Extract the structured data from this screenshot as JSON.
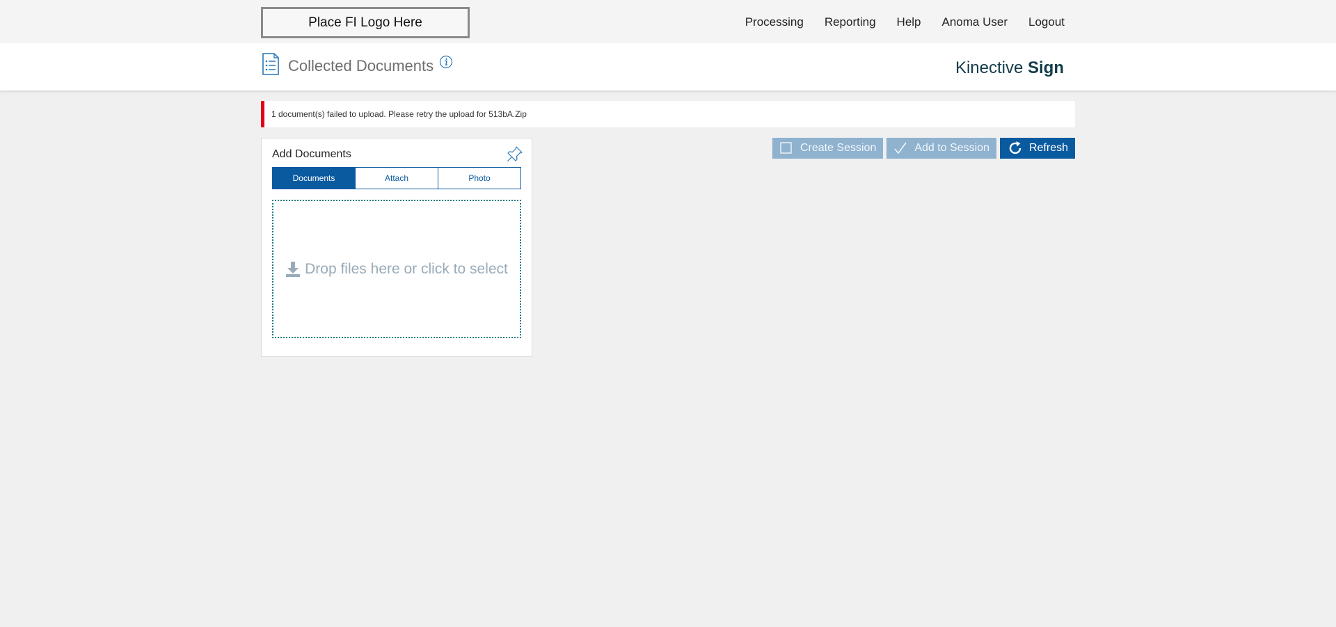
{
  "header": {
    "logo_text": "Place FI Logo Here",
    "nav": [
      {
        "label": "Processing"
      },
      {
        "label": "Reporting"
      },
      {
        "label": "Help"
      },
      {
        "label": "Anoma User"
      },
      {
        "label": "Logout"
      }
    ]
  },
  "page": {
    "title": "Collected Documents",
    "brand_light": "Kinective ",
    "brand_bold": "Sign"
  },
  "alert": {
    "message": "1 document(s) failed to upload. Please retry the upload for 513bA.Zip",
    "color": "#e3001b"
  },
  "actions": {
    "create_session": "Create Session",
    "add_to_session": "Add to Session",
    "refresh": "Refresh"
  },
  "panel": {
    "title": "Add Documents",
    "tabs": [
      {
        "label": "Documents",
        "active": true
      },
      {
        "label": "Attach",
        "active": false
      },
      {
        "label": "Photo",
        "active": false
      }
    ],
    "dropzone_text": "Drop files here or click to select"
  },
  "colors": {
    "primary": "#0a5aa0",
    "disabled_button": "#8fb2cf",
    "brand_text": "#133c4a",
    "dropzone_border": "#1a7d80"
  },
  "icons": {
    "title": "document-list-icon",
    "info": "info-icon",
    "pin": "pin-icon",
    "create": "checkbox-icon",
    "add": "checkmark-icon",
    "refresh": "refresh-icon",
    "drop": "download-icon"
  }
}
